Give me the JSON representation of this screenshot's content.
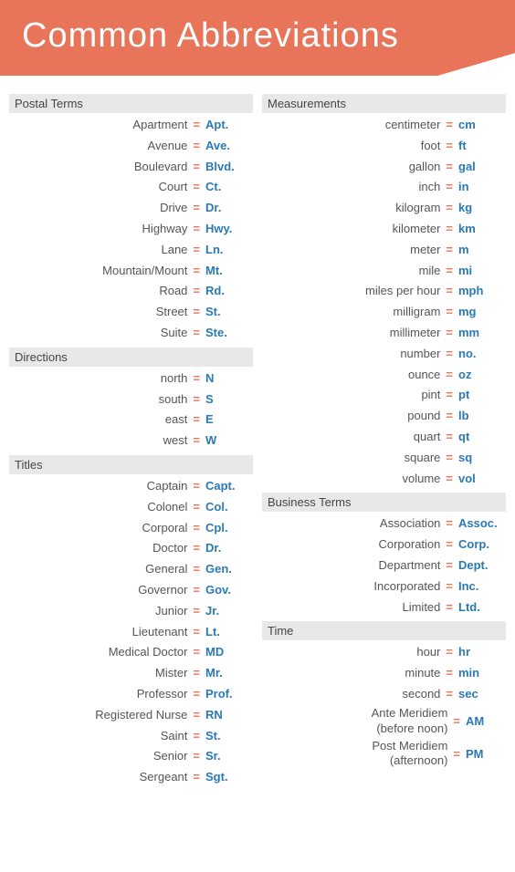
{
  "header": {
    "title": "Common Abbreviations"
  },
  "left_column": {
    "sections": [
      {
        "header": "Postal Terms",
        "items": [
          {
            "term": "Apartment",
            "abbr": "Apt."
          },
          {
            "term": "Avenue",
            "abbr": "Ave."
          },
          {
            "term": "Boulevard",
            "abbr": "Blvd."
          },
          {
            "term": "Court",
            "abbr": "Ct."
          },
          {
            "term": "Drive",
            "abbr": "Dr."
          },
          {
            "term": "Highway",
            "abbr": "Hwy."
          },
          {
            "term": "Lane",
            "abbr": "Ln."
          },
          {
            "term": "Mountain/Mount",
            "abbr": "Mt."
          },
          {
            "term": "Road",
            "abbr": "Rd."
          },
          {
            "term": "Street",
            "abbr": "St."
          },
          {
            "term": "Suite",
            "abbr": "Ste."
          }
        ]
      },
      {
        "header": "Directions",
        "items": [
          {
            "term": "north",
            "abbr": "N"
          },
          {
            "term": "south",
            "abbr": "S"
          },
          {
            "term": "east",
            "abbr": "E"
          },
          {
            "term": "west",
            "abbr": "W"
          }
        ]
      },
      {
        "header": "Titles",
        "items": [
          {
            "term": "Captain",
            "abbr": "Capt."
          },
          {
            "term": "Colonel",
            "abbr": "Col."
          },
          {
            "term": "Corporal",
            "abbr": "Cpl."
          },
          {
            "term": "Doctor",
            "abbr": "Dr."
          },
          {
            "term": "General",
            "abbr": "Gen."
          },
          {
            "term": "Governor",
            "abbr": "Gov."
          },
          {
            "term": "Junior",
            "abbr": "Jr."
          },
          {
            "term": "Lieutenant",
            "abbr": "Lt."
          },
          {
            "term": "Medical Doctor",
            "abbr": "MD"
          },
          {
            "term": "Mister",
            "abbr": "Mr."
          },
          {
            "term": "Professor",
            "abbr": "Prof."
          },
          {
            "term": "Registered Nurse",
            "abbr": "RN"
          },
          {
            "term": "Saint",
            "abbr": "St."
          },
          {
            "term": "Senior",
            "abbr": "Sr."
          },
          {
            "term": "Sergeant",
            "abbr": "Sgt."
          }
        ]
      }
    ]
  },
  "right_column": {
    "sections": [
      {
        "header": "Measurements",
        "items": [
          {
            "term": "centimeter",
            "abbr": "cm"
          },
          {
            "term": "foot",
            "abbr": "ft"
          },
          {
            "term": "gallon",
            "abbr": "gal"
          },
          {
            "term": "inch",
            "abbr": "in"
          },
          {
            "term": "kilogram",
            "abbr": "kg"
          },
          {
            "term": "kilometer",
            "abbr": "km"
          },
          {
            "term": "meter",
            "abbr": "m"
          },
          {
            "term": "mile",
            "abbr": "mi"
          },
          {
            "term": "miles per hour",
            "abbr": "mph"
          },
          {
            "term": "milligram",
            "abbr": "mg"
          },
          {
            "term": "millimeter",
            "abbr": "mm"
          },
          {
            "term": "number",
            "abbr": "no."
          },
          {
            "term": "ounce",
            "abbr": "oz"
          },
          {
            "term": "pint",
            "abbr": "pt"
          },
          {
            "term": "pound",
            "abbr": "lb"
          },
          {
            "term": "quart",
            "abbr": "qt"
          },
          {
            "term": "square",
            "abbr": "sq"
          },
          {
            "term": "volume",
            "abbr": "vol"
          }
        ]
      },
      {
        "header": "Business Terms",
        "items": [
          {
            "term": "Association",
            "abbr": "Assoc."
          },
          {
            "term": "Corporation",
            "abbr": "Corp."
          },
          {
            "term": "Department",
            "abbr": "Dept."
          },
          {
            "term": "Incorporated",
            "abbr": "Inc."
          },
          {
            "term": "Limited",
            "abbr": "Ltd."
          }
        ]
      },
      {
        "header": "Time",
        "items": [
          {
            "term": "hour",
            "abbr": "hr"
          },
          {
            "term": "minute",
            "abbr": "min"
          },
          {
            "term": "second",
            "abbr": "sec"
          },
          {
            "term": "Ante Meridiem\n(before noon)",
            "abbr": "AM",
            "multiline": true
          },
          {
            "term": "Post Meridiem\n(afternoon)",
            "abbr": "PM",
            "multiline": true
          }
        ]
      }
    ]
  },
  "equals_sign": "=",
  "colors": {
    "accent": "#e8755a",
    "abbr": "#2a7ab5",
    "section_bg": "#e8e8e8"
  }
}
